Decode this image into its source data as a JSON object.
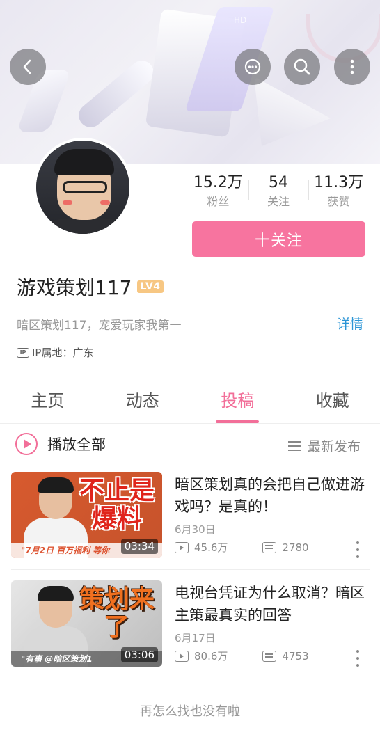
{
  "header": {
    "icons": [
      "back-arrow-icon",
      "message-icon",
      "search-icon",
      "more-vertical-icon"
    ],
    "banner_badge": "HD"
  },
  "profile": {
    "stats": [
      {
        "value": "15.2万",
        "label": "粉丝"
      },
      {
        "value": "54",
        "label": "关注"
      },
      {
        "value": "11.3万",
        "label": "获赞"
      }
    ],
    "follow_label": "十关注",
    "username": "游戏策划117",
    "level": "LV4",
    "bio": "暗区策划117，宠爱玩家我第一",
    "detail_link": "详情",
    "ip_icon_text": "IP",
    "ip_location": "IP属地：广东"
  },
  "tabs": [
    {
      "label": "主页",
      "active": false
    },
    {
      "label": "动态",
      "active": false
    },
    {
      "label": "投稿",
      "active": true
    },
    {
      "label": "收藏",
      "active": false
    }
  ],
  "list_header": {
    "play_all": "播放全部",
    "sort_label": "最新发布"
  },
  "videos": [
    {
      "thumb_text": "不止是爆料",
      "thumb_strip": "\"7月2日 百万福利 等你",
      "duration": "03:34",
      "title": "暗区策划真的会把自己做进游戏吗？是真的！",
      "date": "6月30日",
      "plays": "45.6万",
      "danmaku": "2780"
    },
    {
      "thumb_text": "策划来了",
      "thumb_strip": "\"有事 @暗区策划1",
      "duration": "03:06",
      "title": "电视台凭证为什么取消？暗区主策最真实的回答",
      "date": "6月17日",
      "plays": "80.6万",
      "danmaku": "4753"
    }
  ],
  "footer_text": "再怎么找也没有啦",
  "colors": {
    "accent_pink": "#f26f99",
    "follow_button": "#f7749f",
    "link_blue": "#2b95d6",
    "level_badge": "#f7c783"
  }
}
